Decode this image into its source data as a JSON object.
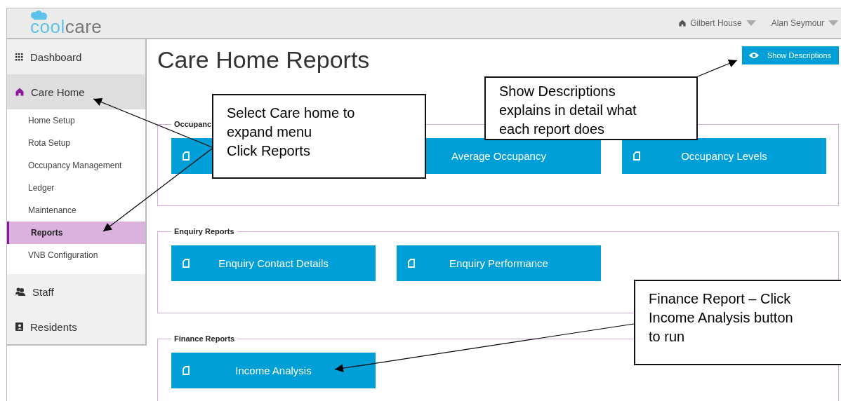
{
  "header": {
    "logo": [
      "cool",
      "care"
    ],
    "home": "Gilbert House",
    "user": "Alan Seymour"
  },
  "sidebar": {
    "items": [
      {
        "label": "Dashboard",
        "expanded": false
      },
      {
        "label": "Care Home",
        "expanded": true,
        "children": [
          {
            "label": "Home Setup",
            "selected": false
          },
          {
            "label": "Rota Setup",
            "selected": false
          },
          {
            "label": "Occupancy Management",
            "selected": false
          },
          {
            "label": "Ledger",
            "selected": false
          },
          {
            "label": "Maintenance",
            "selected": false
          },
          {
            "label": "Reports",
            "selected": true
          },
          {
            "label": "VNB Configuration",
            "selected": false
          }
        ]
      },
      {
        "label": "Staff",
        "expanded": false
      },
      {
        "label": "Residents",
        "expanded": false
      }
    ]
  },
  "page": {
    "title": "Care Home Reports",
    "show_descriptions": "Show Descriptions"
  },
  "sections": [
    {
      "legend": "Occupanc",
      "buttons": [
        {
          "kind": "report"
        },
        {
          "kind": "plain",
          "label": "Average Occupancy"
        },
        {
          "kind": "report",
          "label": "Occupancy Levels"
        }
      ]
    },
    {
      "legend": "Enquiry Reports",
      "buttons": [
        {
          "kind": "report",
          "label": "Enquiry Contact Details"
        },
        {
          "kind": "report",
          "label": "Enquiry Performance"
        }
      ]
    },
    {
      "legend": "Finance Reports",
      "buttons": [
        {
          "kind": "report",
          "label": "Income Analysis"
        }
      ]
    }
  ],
  "callouts": [
    {
      "lines": [
        "Select Care home to",
        "expand menu",
        "Click Reports"
      ]
    },
    {
      "lines": [
        "Show Descriptions",
        "explains in detail what",
        "each report does"
      ]
    },
    {
      "lines": [
        "Finance Report – Click",
        "Income Analysis button",
        "to run"
      ]
    }
  ]
}
